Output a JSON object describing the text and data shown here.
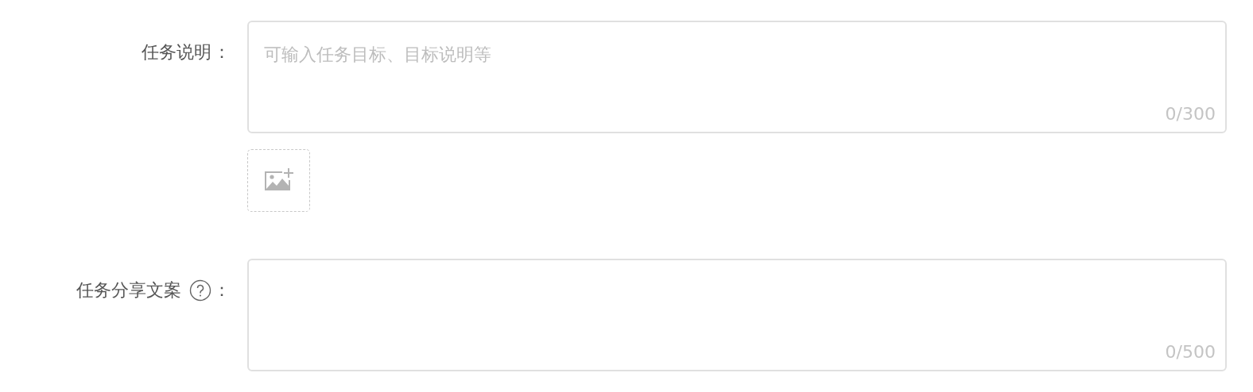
{
  "fields": [
    {
      "kind": "textarea",
      "label": "任务说明",
      "help": false,
      "suffix": "：",
      "placeholder": "可输入任务目标、目标说明等",
      "counter": "0/300",
      "image_upload": true
    },
    {
      "kind": "textarea",
      "label": "任务分享文案",
      "help": true,
      "suffix": "：",
      "counter": "0/500",
      "image_upload": false
    }
  ]
}
